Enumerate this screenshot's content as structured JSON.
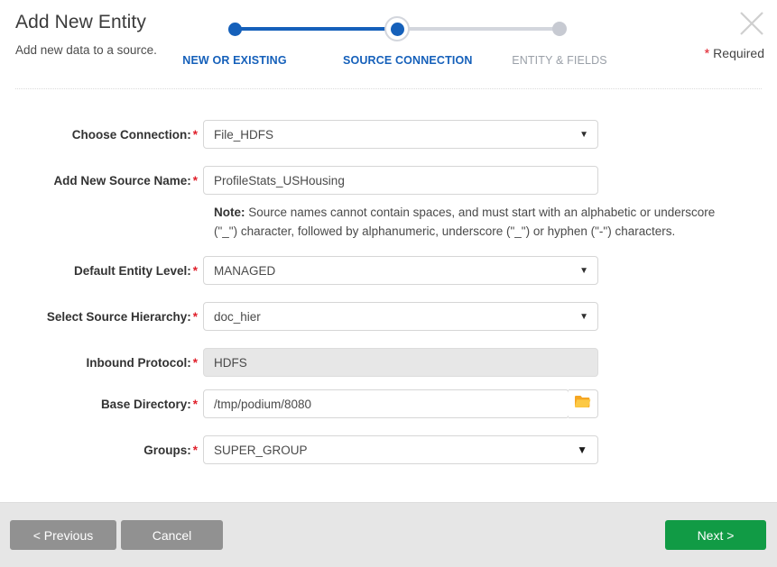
{
  "header": {
    "title": "Add New Entity",
    "subtitle": "Add new data to a source.",
    "required_star": "*",
    "required_label": "Required",
    "close_icon": "close-icon"
  },
  "stepper": {
    "steps": [
      {
        "label": "NEW OR EXISTING",
        "state": "complete"
      },
      {
        "label": "SOURCE CONNECTION",
        "state": "active"
      },
      {
        "label": "ENTITY & FIELDS",
        "state": "upcoming"
      }
    ],
    "active_color": "#1560ba",
    "inactive_color": "#c7cad2"
  },
  "form": {
    "required_marker": "*",
    "fields": [
      {
        "label": "Choose Connection:",
        "type": "select",
        "value": "File_HDFS",
        "required": true,
        "caret": "chevron-down-icon"
      },
      {
        "label": "Add New Source Name:",
        "type": "text",
        "value": "ProfileStats_USHousing",
        "placeholder": "",
        "required": true
      },
      {
        "label": "Default Entity Level:",
        "type": "select",
        "value": "MANAGED",
        "required": true,
        "caret": "chevron-down-icon"
      },
      {
        "label": "Select Source Hierarchy:",
        "type": "select",
        "value": "doc_hier",
        "required": true,
        "caret": "chevron-down-icon"
      },
      {
        "label": "Inbound Protocol:",
        "type": "text-disabled",
        "value": "HDFS",
        "required": true
      },
      {
        "label": "Base Directory:",
        "type": "text-browse",
        "value": "/tmp/podium/8080",
        "required": true,
        "browse_icon": "folder-icon"
      },
      {
        "label": "Groups:",
        "type": "select",
        "value": "SUPER_GROUP",
        "required": true,
        "caret": "chevron-down-icon"
      }
    ],
    "note": {
      "prefix": "Note:",
      "text": " Source names cannot contain spaces, and must start with an alphabetic or underscore (\"_\") character, followed by alphanumeric, underscore (\"_\") or hyphen (\"-\") characters."
    }
  },
  "footer": {
    "previous_label": "< Previous",
    "cancel_label": "Cancel",
    "next_label": "Next >",
    "next_color": "#119b45",
    "secondary_color": "#919191"
  }
}
